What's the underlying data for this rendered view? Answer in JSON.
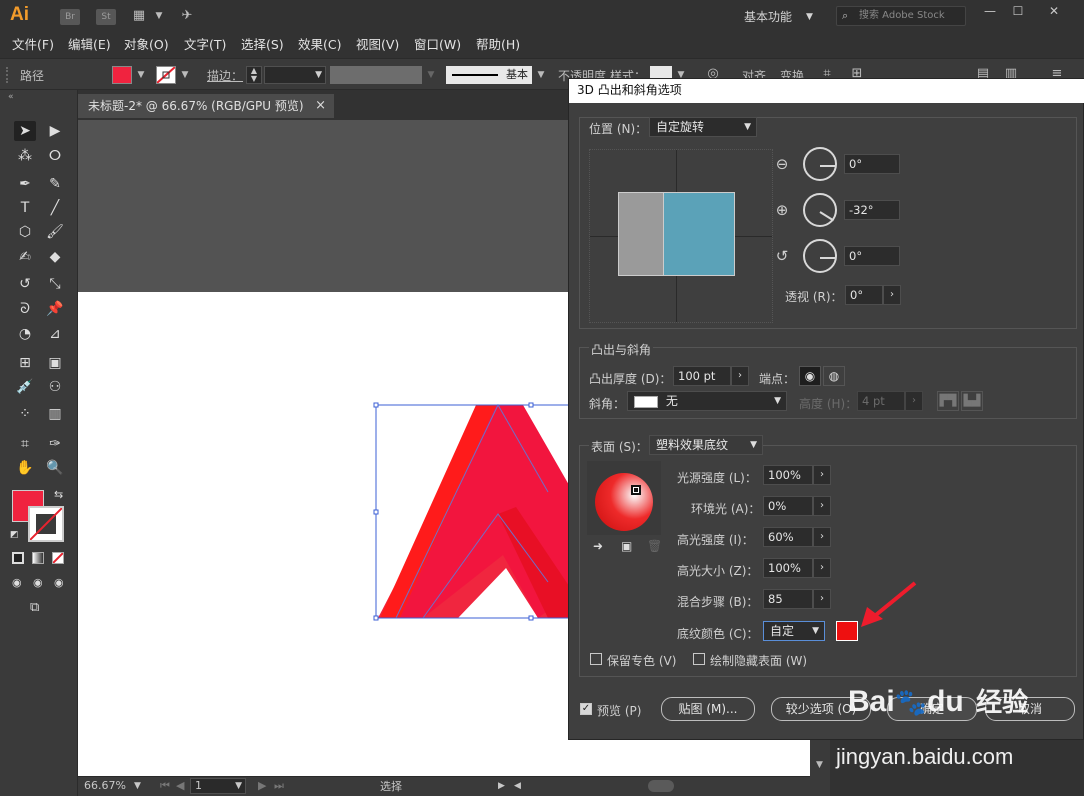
{
  "app": {
    "logo": "Ai",
    "bridge": "Br",
    "stock": "St",
    "workspace": "基本功能",
    "search_placeholder": "搜索 Adobe Stock"
  },
  "menu": [
    "文件(F)",
    "编辑(E)",
    "对象(O)",
    "文字(T)",
    "选择(S)",
    "效果(C)",
    "视图(V)",
    "窗口(W)",
    "帮助(H)"
  ],
  "control": {
    "object_label": "路径",
    "stroke_label": "描边：",
    "stroke_style": "基本",
    "opacity_label": "不透明度",
    "style_label": "样式：",
    "align_label": "对齐",
    "transform_label": "变换"
  },
  "document": {
    "tab_title": "未标题-2* @ 66.67% (RGB/GPU 预览)",
    "close_glyph": "×"
  },
  "status": {
    "zoom": "66.67%",
    "page": "1",
    "tool": "选择"
  },
  "dialog": {
    "title": "3D 凸出和斜角选项",
    "position_label": "位置 (N)：",
    "position_value": "自定旋转",
    "rot_x": "0°",
    "rot_y": "-32°",
    "rot_z": "0°",
    "perspective_label": "透视 (R)：",
    "perspective_value": "0°",
    "extrude_group": "凸出与斜角",
    "extrude_depth_label": "凸出厚度 (D)：",
    "extrude_depth_value": "100 pt",
    "cap_label": "端点：",
    "bevel_label": "斜角：",
    "bevel_value": "无",
    "height_label": "高度 (H)：",
    "height_value": "4 pt",
    "surface_label": "表面 (S)：",
    "surface_value": "塑料效果底纹",
    "light_intensity_label": "光源强度 (L)：",
    "light_intensity_value": "100%",
    "ambient_label": "环境光 (A)：",
    "ambient_value": "0%",
    "highlight_intensity_label": "高光强度 (I)：",
    "highlight_intensity_value": "60%",
    "highlight_size_label": "高光大小 (Z)：",
    "highlight_size_value": "100%",
    "blend_steps_label": "混合步骤 (B)：",
    "blend_steps_value": "85",
    "shading_color_label": "底纹颜色 (C)：",
    "shading_color_value": "自定",
    "preserve_spot_label": "保留专色 (V)",
    "draw_hidden_label": "绘制隐藏表面 (W)",
    "preview_label": "预览 (P)",
    "map_art_button": "贴图 (M)...",
    "fewer_options_button": "较少选项 (O)",
    "ok_button": "确定",
    "cancel_button": "取消"
  },
  "watermark": {
    "brand": "Bai",
    "brand2": "du",
    "jingyan": "经验",
    "url": "jingyan.baidu.com"
  },
  "colors": {
    "fill": "#f0233f",
    "shading_color": "#ee1010",
    "arrow": "#ee1c2c"
  }
}
